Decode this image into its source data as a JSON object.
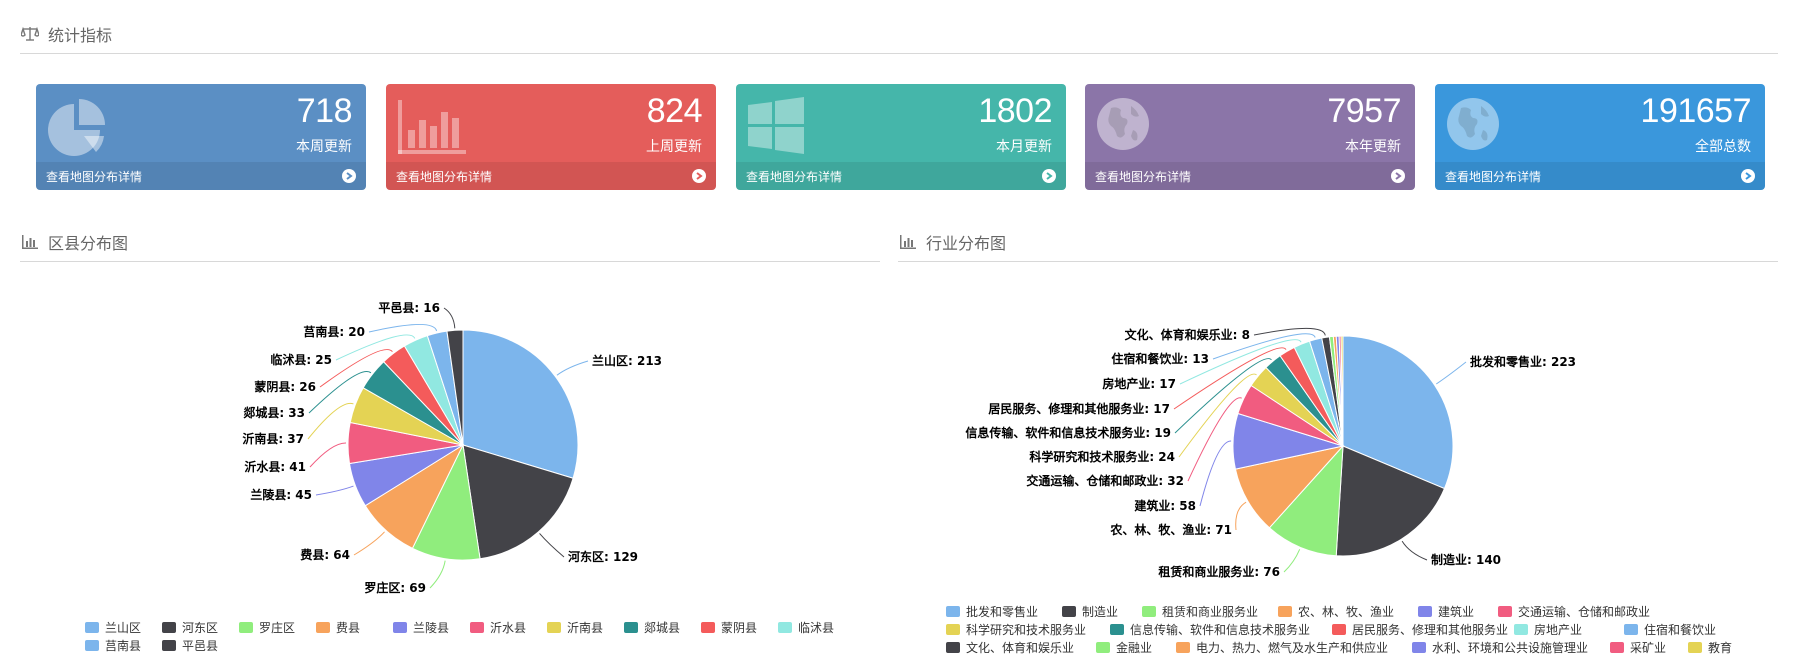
{
  "headers": {
    "stats": "统计指标",
    "district": "区县分布图",
    "industry": "行业分布图"
  },
  "cards": [
    {
      "value": "718",
      "label": "本周更新",
      "link": "查看地图分布详情",
      "color": "#5b8fc4",
      "icon": "pie-chart-icon"
    },
    {
      "value": "824",
      "label": "上周更新",
      "link": "查看地图分布详情",
      "color": "#e45d5b",
      "icon": "bar-chart-icon"
    },
    {
      "value": "1802",
      "label": "本月更新",
      "link": "查看地图分布详情",
      "color": "#45b6aa",
      "icon": "windows-icon"
    },
    {
      "value": "7957",
      "label": "本年更新",
      "link": "查看地图分布详情",
      "color": "#8b75a8",
      "icon": "globe-icon"
    },
    {
      "value": "191657",
      "label": "全部总数",
      "link": "查看地图分布详情",
      "color": "#3a97dc",
      "icon": "globe-icon"
    }
  ],
  "chart_data": [
    {
      "type": "pie",
      "slices": [
        {
          "name": "兰山区",
          "value": 213,
          "color": "#7cb5ec"
        },
        {
          "name": "河东区",
          "value": 129,
          "color": "#434348"
        },
        {
          "name": "罗庄区",
          "value": 69,
          "color": "#90ed7d"
        },
        {
          "name": "费县",
          "value": 64,
          "color": "#f7a35c"
        },
        {
          "name": "兰陵县",
          "value": 45,
          "color": "#8085e9"
        },
        {
          "name": "沂水县",
          "value": 41,
          "color": "#f15c80"
        },
        {
          "name": "沂南县",
          "value": 37,
          "color": "#e4d354"
        },
        {
          "name": "郯城县",
          "value": 33,
          "color": "#2b908f"
        },
        {
          "name": "蒙阴县",
          "value": 26,
          "color": "#f45b5b"
        },
        {
          "name": "临沭县",
          "value": 25,
          "color": "#91e8e1"
        },
        {
          "name": "莒南县",
          "value": 20,
          "color": "#7cb5ec"
        },
        {
          "name": "平邑县",
          "value": 16,
          "color": "#434348"
        }
      ]
    },
    {
      "type": "pie",
      "slices": [
        {
          "name": "批发和零售业",
          "value": 223,
          "color": "#7cb5ec"
        },
        {
          "name": "制造业",
          "value": 140,
          "color": "#434348"
        },
        {
          "name": "租赁和商业服务业",
          "value": 76,
          "color": "#90ed7d"
        },
        {
          "name": "农、林、牧、渔业",
          "value": 71,
          "color": "#f7a35c"
        },
        {
          "name": "建筑业",
          "value": 58,
          "color": "#8085e9"
        },
        {
          "name": "交通运输、仓储和邮政业",
          "value": 32,
          "color": "#f15c80"
        },
        {
          "name": "科学研究和技术服务业",
          "value": 24,
          "color": "#e4d354"
        },
        {
          "name": "信息传输、软件和信息技术服务业",
          "value": 19,
          "color": "#2b908f"
        },
        {
          "name": "居民服务、修理和其他服务业",
          "value": 17,
          "color": "#f45b5b"
        },
        {
          "name": "房地产业",
          "value": 17,
          "color": "#91e8e1"
        },
        {
          "name": "住宿和餐饮业",
          "value": 13,
          "color": "#7cb5ec"
        },
        {
          "name": "文化、体育和娱乐业",
          "value": 8,
          "color": "#434348"
        },
        {
          "name": "金融业",
          "value": 4,
          "color": "#90ed7d"
        },
        {
          "name": "电力、热力、燃气及水生产和供应业",
          "value": 3,
          "color": "#f7a35c"
        },
        {
          "name": "水利、环境和公共设施管理业",
          "value": 3,
          "color": "#8085e9"
        },
        {
          "name": "采矿业",
          "value": 2,
          "color": "#f15c80"
        },
        {
          "name": "教育",
          "value": 2,
          "color": "#e4d354"
        }
      ]
    }
  ]
}
